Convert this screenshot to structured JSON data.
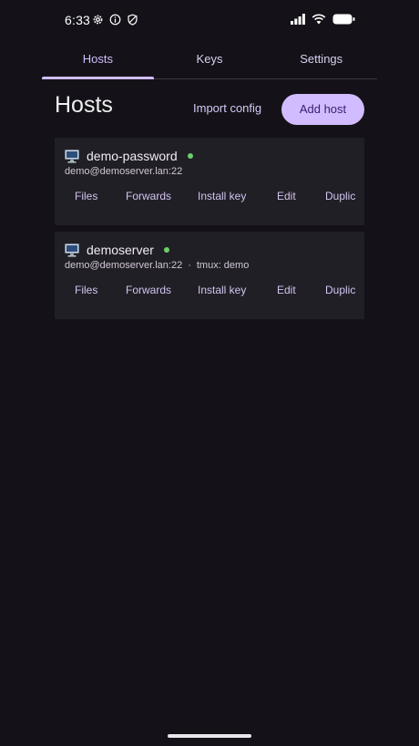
{
  "status_bar": {
    "time": "6:33",
    "left_icons": [
      "gear-icon",
      "info-icon",
      "shield-icon"
    ],
    "right_icons": [
      "signal-icon",
      "wifi-icon",
      "battery-icon"
    ]
  },
  "tabs": [
    {
      "label": "Hosts",
      "active": true
    },
    {
      "label": "Keys",
      "active": false
    },
    {
      "label": "Settings",
      "active": false
    }
  ],
  "header": {
    "title": "Hosts",
    "import_label": "Import config",
    "add_label": "Add host"
  },
  "hosts": [
    {
      "name": "demo-password",
      "address": "demo@demoserver.lan:22",
      "extra_separator": "",
      "extra": "",
      "online": true,
      "actions": [
        "Files",
        "Forwards",
        "Install key",
        "Edit",
        "Duplic"
      ]
    },
    {
      "name": "demoserver",
      "address": "demo@demoserver.lan:22",
      "extra_separator": "·",
      "extra": "tmux: demo",
      "online": true,
      "actions": [
        "Files",
        "Forwards",
        "Install key",
        "Edit",
        "Duplic"
      ]
    }
  ],
  "colors": {
    "background": "#141218",
    "card": "#211f26",
    "accent": "#d0bcff",
    "online": "#6bcf6b"
  }
}
